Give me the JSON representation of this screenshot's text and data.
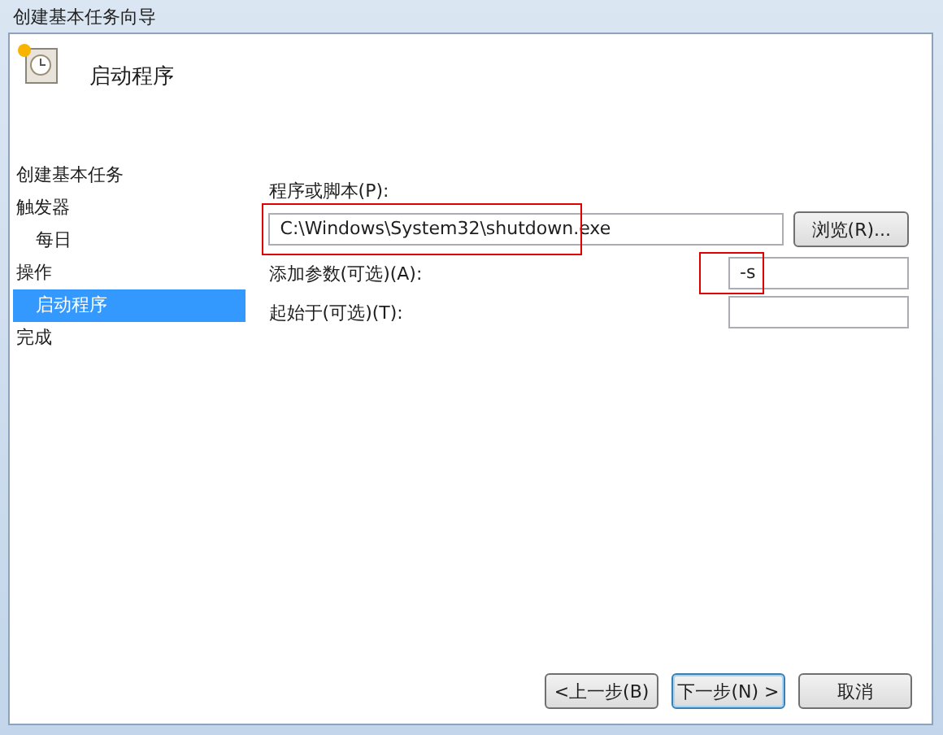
{
  "window": {
    "title": "创建基本任务向导"
  },
  "header": {
    "title": "启动程序"
  },
  "sidebar": {
    "items": [
      {
        "label": "创建基本任务",
        "indented": false,
        "selected": false
      },
      {
        "label": "触发器",
        "indented": false,
        "selected": false
      },
      {
        "label": "每日",
        "indented": true,
        "selected": false
      },
      {
        "label": "操作",
        "indented": false,
        "selected": false
      },
      {
        "label": "启动程序",
        "indented": true,
        "selected": true
      },
      {
        "label": "完成",
        "indented": false,
        "selected": false
      }
    ]
  },
  "program": {
    "label": "程序或脚本(P):",
    "value": "C:\\Windows\\System32\\shutdown.exe",
    "highlighted": true,
    "browse": "浏览(R)..."
  },
  "fields": [
    {
      "label": "添加参数(可选)(A):",
      "value": "-s",
      "highlighted": true
    },
    {
      "label": "起始于(可选)(T):"
    }
  ],
  "buttons": [
    {
      "label": "<上一步(B)",
      "default": false
    },
    {
      "label": "下一步(N) >",
      "default": true
    },
    {
      "label": "取消",
      "default": false
    }
  ]
}
